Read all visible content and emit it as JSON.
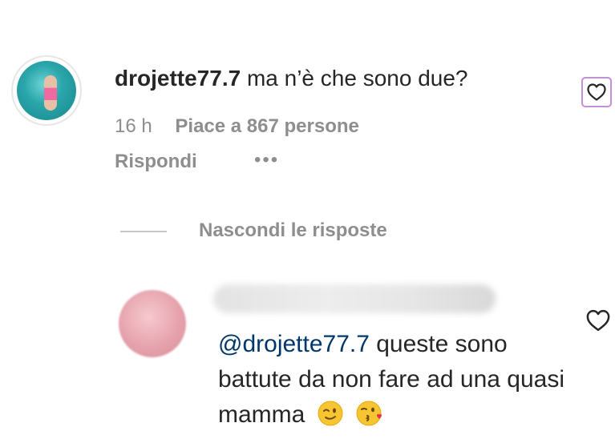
{
  "comment": {
    "username": "drojette77.7",
    "text": "ma n’è che sono due?",
    "time": "16 h",
    "likes": "Piace a 867 persone",
    "reply_label": "Rispondi",
    "more_label": "•••",
    "heart_icon": "heart-outline-icon"
  },
  "thread": {
    "hide_replies_label": "Nascondi le risposte"
  },
  "reply": {
    "mention": "@drojette77.7",
    "text": " queste sono battute da non fare ad una quasi mamma",
    "emojis": [
      "winking-face-emoji",
      "face-blowing-kiss-emoji"
    ],
    "heart_icon": "heart-outline-icon"
  },
  "colors": {
    "text": "#262626",
    "secondary": "#8e8e8e",
    "mention": "#00376b",
    "selection_outline": "#c48fd6"
  }
}
